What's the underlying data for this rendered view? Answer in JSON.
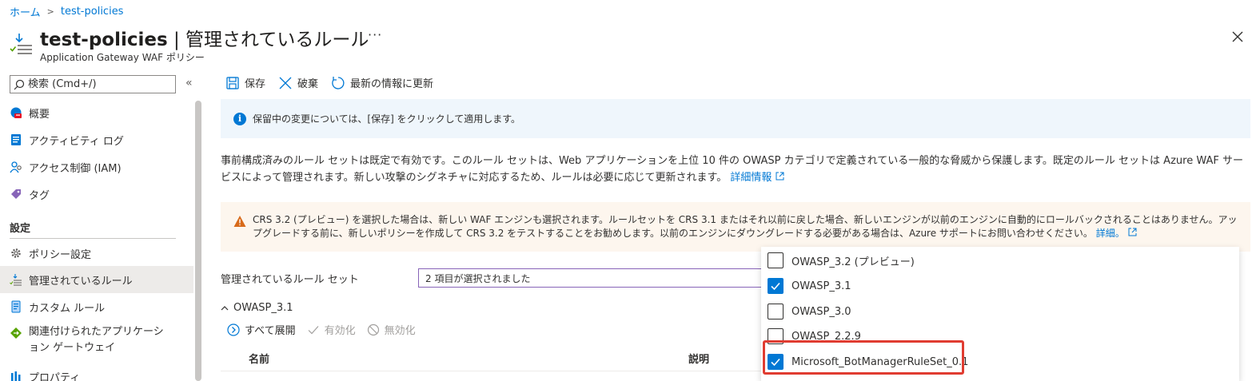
{
  "breadcrumb": {
    "home": "ホーム",
    "current": "test-policies"
  },
  "header": {
    "title_main": "test-policies",
    "title_sep": " | ",
    "title_section": "管理されているルール",
    "more": "···",
    "subtitle": "Application Gateway WAF ポリシー"
  },
  "sidebar": {
    "search_placeholder": "検索 (Cmd+/)",
    "collapse": "«",
    "items_top": [
      {
        "label": "概要",
        "icon": "overview-icon"
      },
      {
        "label": "アクティビティ ログ",
        "icon": "activity-log-icon"
      },
      {
        "label": "アクセス制御 (IAM)",
        "icon": "iam-icon"
      },
      {
        "label": "タグ",
        "icon": "tag-icon"
      }
    ],
    "section_settings": "設定",
    "items_settings": [
      {
        "label": "ポリシー設定",
        "icon": "gear-icon"
      },
      {
        "label": "管理されているルール",
        "icon": "managed-rules-icon",
        "active": true
      },
      {
        "label": "カスタム ルール",
        "icon": "custom-rules-icon"
      },
      {
        "label": "関連付けられたアプリケーション ゲートウェイ",
        "icon": "app-gateway-icon"
      },
      {
        "label": "プロパティ",
        "icon": "properties-icon"
      }
    ]
  },
  "toolbar": {
    "save": "保存",
    "discard": "破棄",
    "refresh": "最新の情報に更新"
  },
  "info_banner": {
    "text": "保留中の変更については、[保存] をクリックして適用します。"
  },
  "description": {
    "text": "事前構成済みのルール セットは既定で有効です。このルール セットは、Web アプリケーションを上位 10 件の OWASP カテゴリで定義されている一般的な脅威から保護します。既定のルール セットは Azure WAF サービスによって管理されます。新しい攻撃のシグネチャに対応するため、ルールは必要に応じて更新されます。",
    "link": "詳細情報"
  },
  "warning_banner": {
    "text": "CRS 3.2 (プレビュー) を選択した場合は、新しい WAF エンジンも選択されます。ルールセットを CRS 3.1 またはそれ以前に戻した場合、新しいエンジンが以前のエンジンに自動的にロールバックされることはありません。アップグレードする前に、新しいポリシーを作成して CRS 3.2 をテストすることをお勧めします。以前のエンジンにダウングレードする必要がある場合は、Azure サポートにお問い合わせください。",
    "link": "詳細。"
  },
  "ruleset": {
    "label": "管理されているルール セット",
    "value": "2 項目が選択されました"
  },
  "group": {
    "name": "OWASP_3.1",
    "expand_all": "すべて展開",
    "enable": "有効化",
    "disable": "無効化"
  },
  "table": {
    "col_name": "名前",
    "col_desc": "説明"
  },
  "dropdown": {
    "options": [
      {
        "label": "OWASP_3.2 (プレビュー)",
        "checked": false
      },
      {
        "label": "OWASP_3.1",
        "checked": true
      },
      {
        "label": "OWASP_3.0",
        "checked": false
      },
      {
        "label": "OWASP_2.2.9",
        "checked": false
      },
      {
        "label": "Microsoft_BotManagerRuleSet_0.1",
        "checked": true
      }
    ]
  },
  "colors": {
    "accent": "#0078d4",
    "highlight": "#e03c31",
    "active_nav": "#edebe9",
    "info_bg": "#eff6fc",
    "warn_bg": "#fdf6ee"
  }
}
